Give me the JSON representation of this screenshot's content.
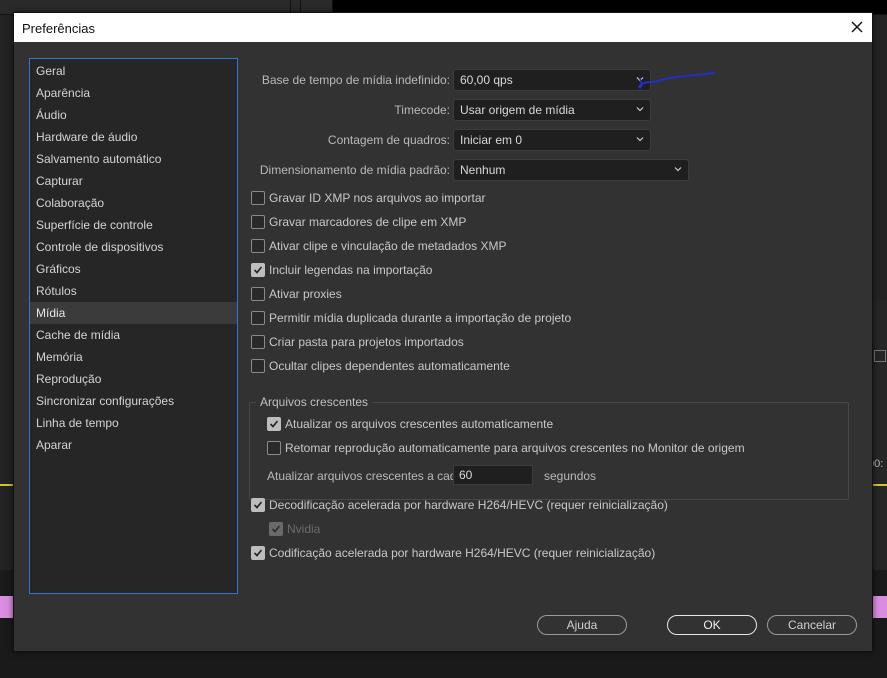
{
  "background": {
    "time_fragment": "00:"
  },
  "dialog": {
    "title": "Preferências"
  },
  "sidebar": {
    "items": [
      {
        "label": "Geral"
      },
      {
        "label": "Aparência"
      },
      {
        "label": "Áudio"
      },
      {
        "label": "Hardware de áudio"
      },
      {
        "label": "Salvamento automático"
      },
      {
        "label": "Capturar"
      },
      {
        "label": "Colaboração"
      },
      {
        "label": "Superfície de controle"
      },
      {
        "label": "Controle de dispositivos"
      },
      {
        "label": "Gráficos"
      },
      {
        "label": "Rótulos"
      },
      {
        "label": "Mídia"
      },
      {
        "label": "Cache de mídia"
      },
      {
        "label": "Memória"
      },
      {
        "label": "Reprodução"
      },
      {
        "label": "Sincronizar configurações"
      },
      {
        "label": "Linha de tempo"
      },
      {
        "label": "Aparar"
      }
    ],
    "selected": "Mídia"
  },
  "media": {
    "timebase": {
      "label": "Base de tempo de mídia indefinido:",
      "value": "60,00  qps"
    },
    "timecode": {
      "label": "Timecode:",
      "value": "Usar origem de mídia"
    },
    "frame_count": {
      "label": "Contagem de quadros:",
      "value": "Iniciar em 0"
    },
    "scaling": {
      "label": "Dimensionamento de mídia padrão:",
      "value": "Nenhum"
    },
    "checkboxes": [
      {
        "label": "Gravar ID XMP nos arquivos ao importar",
        "checked": false
      },
      {
        "label": "Gravar marcadores de clipe em XMP",
        "checked": false
      },
      {
        "label": "Ativar clipe e vinculação de metadados XMP",
        "checked": false
      },
      {
        "label": "Incluir legendas na importação",
        "checked": true
      },
      {
        "label": "Ativar proxies",
        "checked": false
      },
      {
        "label": "Permitir mídia duplicada durante a importação de projeto",
        "checked": false
      },
      {
        "label": "Criar pasta para projetos importados",
        "checked": false
      },
      {
        "label": "Ocultar clipes dependentes automaticamente",
        "checked": false
      }
    ],
    "growing_files": {
      "title": "Arquivos crescentes",
      "auto_refresh": {
        "label": "Atualizar os arquivos crescentes automaticamente",
        "checked": true
      },
      "auto_resume": {
        "label": "Retomar reprodução automaticamente para arquivos crescentes no Monitor de origem",
        "checked": false
      },
      "refresh_label": "Atualizar arquivos crescentes a cada",
      "refresh_value": "60",
      "refresh_unit": "segundos"
    },
    "hw_decode": {
      "label": "Decodificação acelerada por hardware H264/HEVC (requer reinicialização)",
      "checked": true
    },
    "nvidia": {
      "label": "Nvidia",
      "checked": true,
      "disabled": true
    },
    "hw_encode": {
      "label": "Codificação acelerada por hardware H264/HEVC (requer reinicialização)",
      "checked": true
    }
  },
  "buttons": {
    "help": "Ajuda",
    "ok": "OK",
    "cancel": "Cancelar"
  },
  "colors": {
    "accent_border": "#2f78d2",
    "annotation": "#1f2fd0"
  }
}
